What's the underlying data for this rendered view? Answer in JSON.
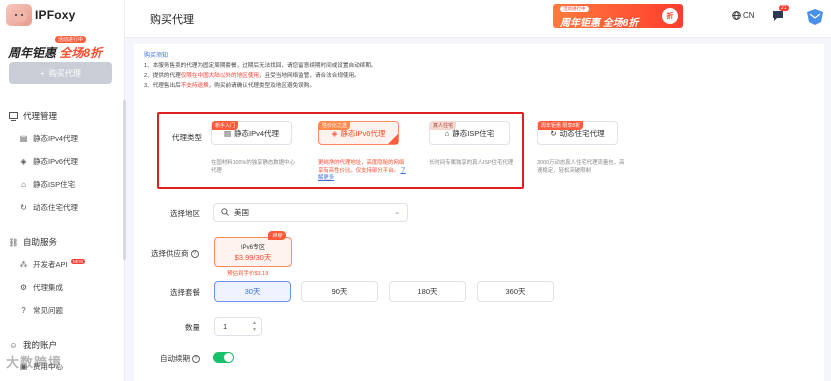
{
  "sidebar": {
    "logo_text": "IPFoxy",
    "promo_tag": "活动进行中",
    "promo_text_a": "周年钜惠",
    "promo_text_b": "全场8折",
    "buy_button": "购买代理",
    "groups": [
      {
        "label": "代理管理",
        "items": [
          "静态IPv4代理",
          "静态IPv6代理",
          "静态ISP住宅",
          "动态住宅代理"
        ]
      },
      {
        "label": "自助服务",
        "items": [
          "开发者API",
          "代理集成",
          "常见问题"
        ]
      },
      {
        "label": "我的账户",
        "items": [
          "费用中心"
        ]
      }
    ],
    "new_badge": "NEW",
    "watermark": "大数跨境"
  },
  "header": {
    "title": "购买代理",
    "banner_tag": "活动进行中",
    "banner_text": "周年钜惠 全场8折",
    "banner_badge": "折",
    "lang": "CN",
    "msg_count": "21"
  },
  "notice": {
    "title": "购买须知",
    "line1": "1、本服务售卖的代理为固定周期套餐，过期后无法找回，请您留意续期时间或设置自动续期。",
    "line2_a": "2、提供的代理",
    "line2_red": "仅限在中国大陆以外的地区使用",
    "line2_b": "，且受当地网络监管，请合法合规使用。",
    "line3_a": "3、代理售出后",
    "line3_red": "不支持退换",
    "line3_b": "，购买前请确认代理类型及地区避免误购。"
  },
  "form": {
    "proxy_type_label": "代理类型",
    "products": [
      {
        "tag": "新手入门",
        "name": "静态IPv4代理",
        "desc": "在国材料100%的独享静态数据中心代理"
      },
      {
        "tag": "性价比之选",
        "name": "静态IPv6代理",
        "desc": "更纯净的代理地址，高度隐秘的网络享有高性价比。仅支持部分平台。",
        "link": "了解更多"
      },
      {
        "tag": "真人住宅",
        "name": "静态ISP住宅",
        "desc": "长时间专属独享的真人ISP住宅代理"
      },
      {
        "tag": "周年钜惠 限享8折",
        "name": "动态住宅代理",
        "desc": "3000万动态真人住宅代理流量包，高速稳定，轻松突破限制"
      }
    ],
    "region_label": "选择地区",
    "region_value": "美国",
    "supplier_label": "选择供应商",
    "supplier_name": "IPv6专区",
    "supplier_price": "$3.99/30天",
    "supplier_tag": "目标",
    "supplier_note": "预估到手价$3.19",
    "plan_label": "选择套餐",
    "plans": [
      "30天",
      "90天",
      "180天",
      "360天"
    ],
    "qty_label": "数量",
    "qty_value": "1",
    "autorenew_label": "自动续期"
  },
  "colors": {
    "accent": "#ff4d2e",
    "primary_blue": "#3b6de0",
    "highlight_border": "#e02020",
    "toggle_on": "#19c26a"
  }
}
